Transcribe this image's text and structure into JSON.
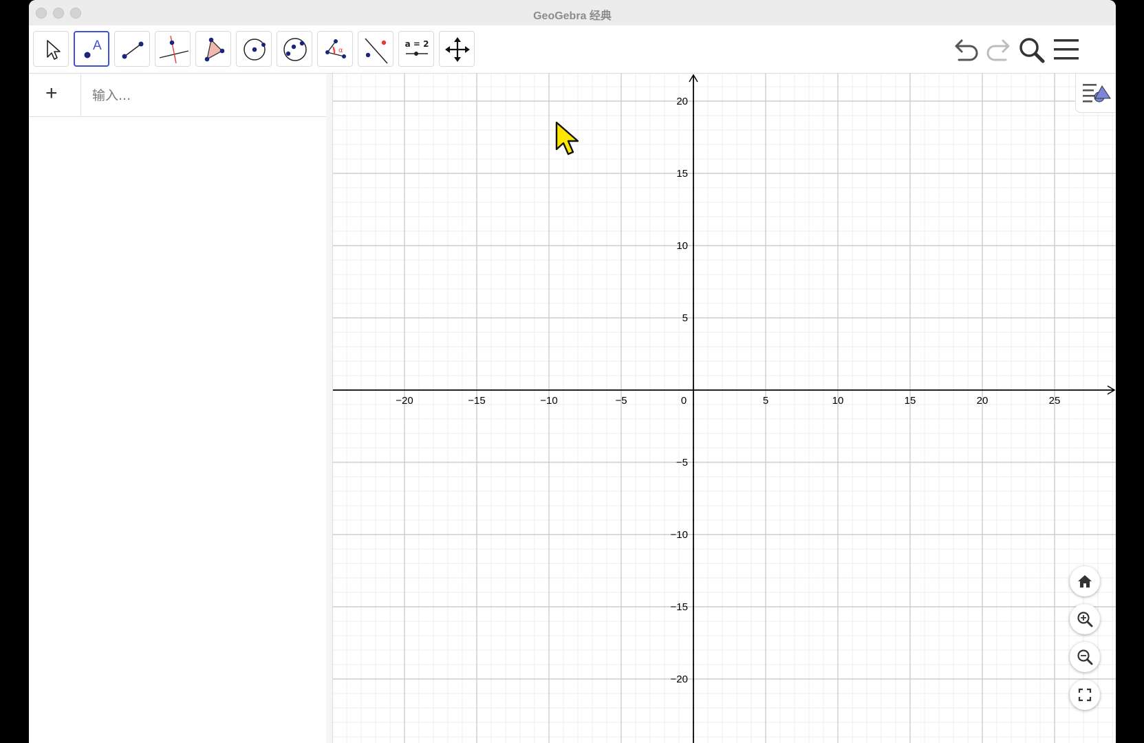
{
  "window": {
    "title": "GeoGebra 经典"
  },
  "toolbar": {
    "tools": [
      {
        "name": "move-tool",
        "icon": "arrow-pointer-icon"
      },
      {
        "name": "point-tool",
        "icon": "point-a-icon",
        "label": "A",
        "selected": true
      },
      {
        "name": "segment-tool",
        "icon": "segment-icon"
      },
      {
        "name": "perpendicular-line-tool",
        "icon": "perpendicular-line-icon"
      },
      {
        "name": "polygon-tool",
        "icon": "polygon-icon"
      },
      {
        "name": "circle-center-point-tool",
        "icon": "circle-center-icon"
      },
      {
        "name": "circle-three-points-tool",
        "icon": "circle-three-points-icon"
      },
      {
        "name": "angle-tool",
        "icon": "angle-icon",
        "label": "α"
      },
      {
        "name": "reflect-tool",
        "icon": "reflect-line-icon"
      },
      {
        "name": "slider-tool",
        "icon": "slider-icon",
        "label": "a = 2"
      },
      {
        "name": "move-graphics-view-tool",
        "icon": "move-arrows-icon"
      }
    ],
    "right": [
      "undo-icon",
      "redo-icon",
      "search-icon",
      "menu-icon"
    ]
  },
  "algebra": {
    "plus_label": "+",
    "input_placeholder": "输入..."
  },
  "graphics": {
    "x_ticks": [
      "−20",
      "−15",
      "−10",
      "−5",
      "0",
      "5",
      "10",
      "15",
      "20",
      "25"
    ],
    "y_ticks": [
      "20",
      "15",
      "10",
      "5",
      "−5",
      "−10",
      "−15",
      "−20"
    ],
    "grid": true,
    "nav_buttons": [
      "home-icon",
      "zoom-in-icon",
      "zoom-out-icon",
      "fullscreen-icon"
    ]
  },
  "colors": {
    "accent": "#3f4fd8",
    "point": "#1a237e",
    "axis": "#000000",
    "cursor": "#ffe600"
  }
}
